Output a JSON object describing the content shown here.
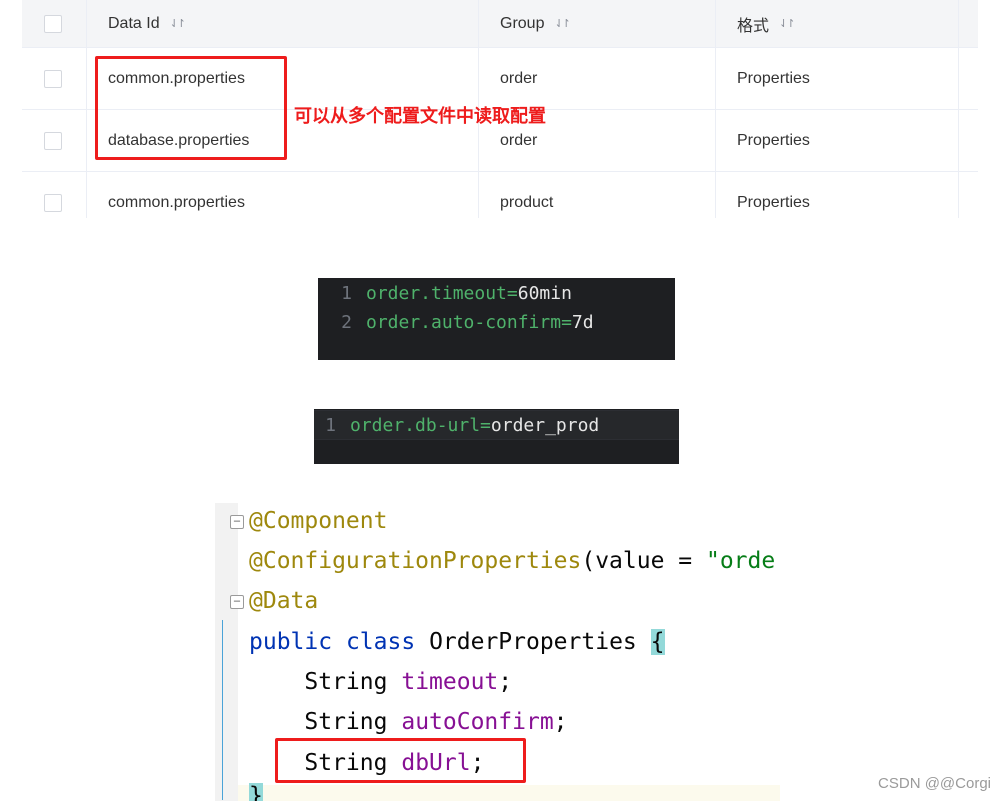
{
  "table": {
    "headers": {
      "data_id": "Data Id",
      "group": "Group",
      "format": "格式",
      "sort_icon": "⇃↾"
    },
    "rows": [
      {
        "data_id": "common.properties",
        "group": "order",
        "format": "Properties"
      },
      {
        "data_id": "database.properties",
        "group": "order",
        "format": "Properties"
      },
      {
        "data_id": "common.properties",
        "group": "product",
        "format": "Properties"
      }
    ],
    "annotation": "可以从多个配置文件中读取配置",
    "annotation_color": "#ee1c1c"
  },
  "editor1": {
    "lines": [
      {
        "num": "1",
        "key": "order.timeout",
        "eq": "=",
        "value": "60min"
      },
      {
        "num": "2",
        "key": "order.auto-confirm",
        "eq": "=",
        "value": "7d"
      }
    ]
  },
  "editor2": {
    "lines": [
      {
        "num": "1",
        "key": "order.db-url",
        "eq": "=",
        "value": "order_prod"
      }
    ]
  },
  "code": {
    "l1": "@Component",
    "l2_ann": "@ConfigurationProperties",
    "l2_rest": "(value = ",
    "l2_str": "\"orde",
    "l3": "@Data",
    "l4_kw1": "public",
    "l4_kw2": "class",
    "l4_name": "OrderProperties",
    "l4_brace": "{",
    "type": "String",
    "f1": "timeout",
    "f2": "autoConfirm",
    "f3": "dbUrl",
    "semi": ";",
    "close": "}"
  },
  "watermark": "CSDN @@Corgi"
}
